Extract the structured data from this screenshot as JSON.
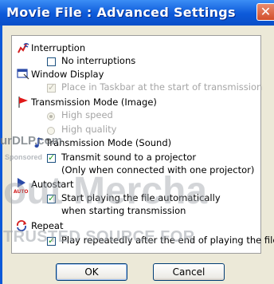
{
  "window": {
    "title": "Movie File : Advanced Settings",
    "close_label": "✕"
  },
  "sections": {
    "interruption": {
      "heading": "Interruption",
      "option": {
        "label": "No interruptions",
        "checked": false
      }
    },
    "window_display": {
      "heading": "Window Display",
      "option": {
        "label": "Place in Taskbar at the start of transmission",
        "checked": true,
        "enabled": false
      }
    },
    "transmission_image": {
      "heading": "Transmission Mode (Image)",
      "options": [
        {
          "label": "High speed",
          "selected": true,
          "enabled": false
        },
        {
          "label": "High quality",
          "selected": false,
          "enabled": false
        }
      ]
    },
    "transmission_sound": {
      "heading": "Transmission Mode (Sound)",
      "option": {
        "label_line1": "Transmit sound to a projector",
        "label_line2": "(Only when connected with one projector)",
        "checked": true
      }
    },
    "autostart": {
      "heading": "Autostart",
      "icon_text": "AUTO",
      "option": {
        "label_line1": "Start playing the file automatically",
        "label_line2": "when starting transmission",
        "checked": true
      }
    },
    "repeat": {
      "heading": "Repeat",
      "option": {
        "label": "Play repeatedly after the end of playing the file",
        "checked": true
      }
    }
  },
  "buttons": {
    "ok": "OK",
    "cancel": "Cancel"
  },
  "watermark": {
    "line1": "urDLP.com",
    "line2": "Sponsored",
    "line3": "out Mercha",
    "line4": "TRUSTED SOURCE FOR"
  },
  "colors": {
    "title_bar": "#0c59d9",
    "dialog_bg": "#ece9d8",
    "close_button": "#d24e2b",
    "check_mark": "#21a121"
  }
}
